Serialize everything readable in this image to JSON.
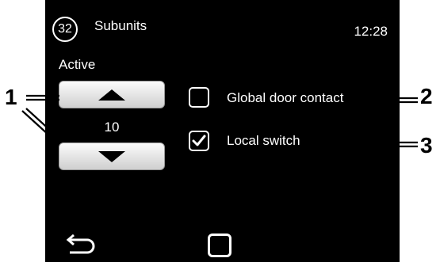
{
  "status_bar": {
    "badge_number": "32",
    "title": "Subunits",
    "time": "12:28"
  },
  "main": {
    "active_label": "Active",
    "counter_value": "10",
    "up_button_icon": "triangle-up-icon",
    "down_button_icon": "triangle-down-icon"
  },
  "options": [
    {
      "label": "Global door contact",
      "checked": false
    },
    {
      "label": "Local switch",
      "checked": true
    }
  ],
  "nav": {
    "back_icon": "back-arrow-icon",
    "home_icon": "home-square-icon"
  },
  "callouts": [
    "1",
    "2",
    "3"
  ],
  "colors": {
    "screen_background": "#000000",
    "text": "#ffffff",
    "button_top": "#fbfbfb",
    "button_bottom": "#cfcfcf",
    "callout": "#000000"
  }
}
